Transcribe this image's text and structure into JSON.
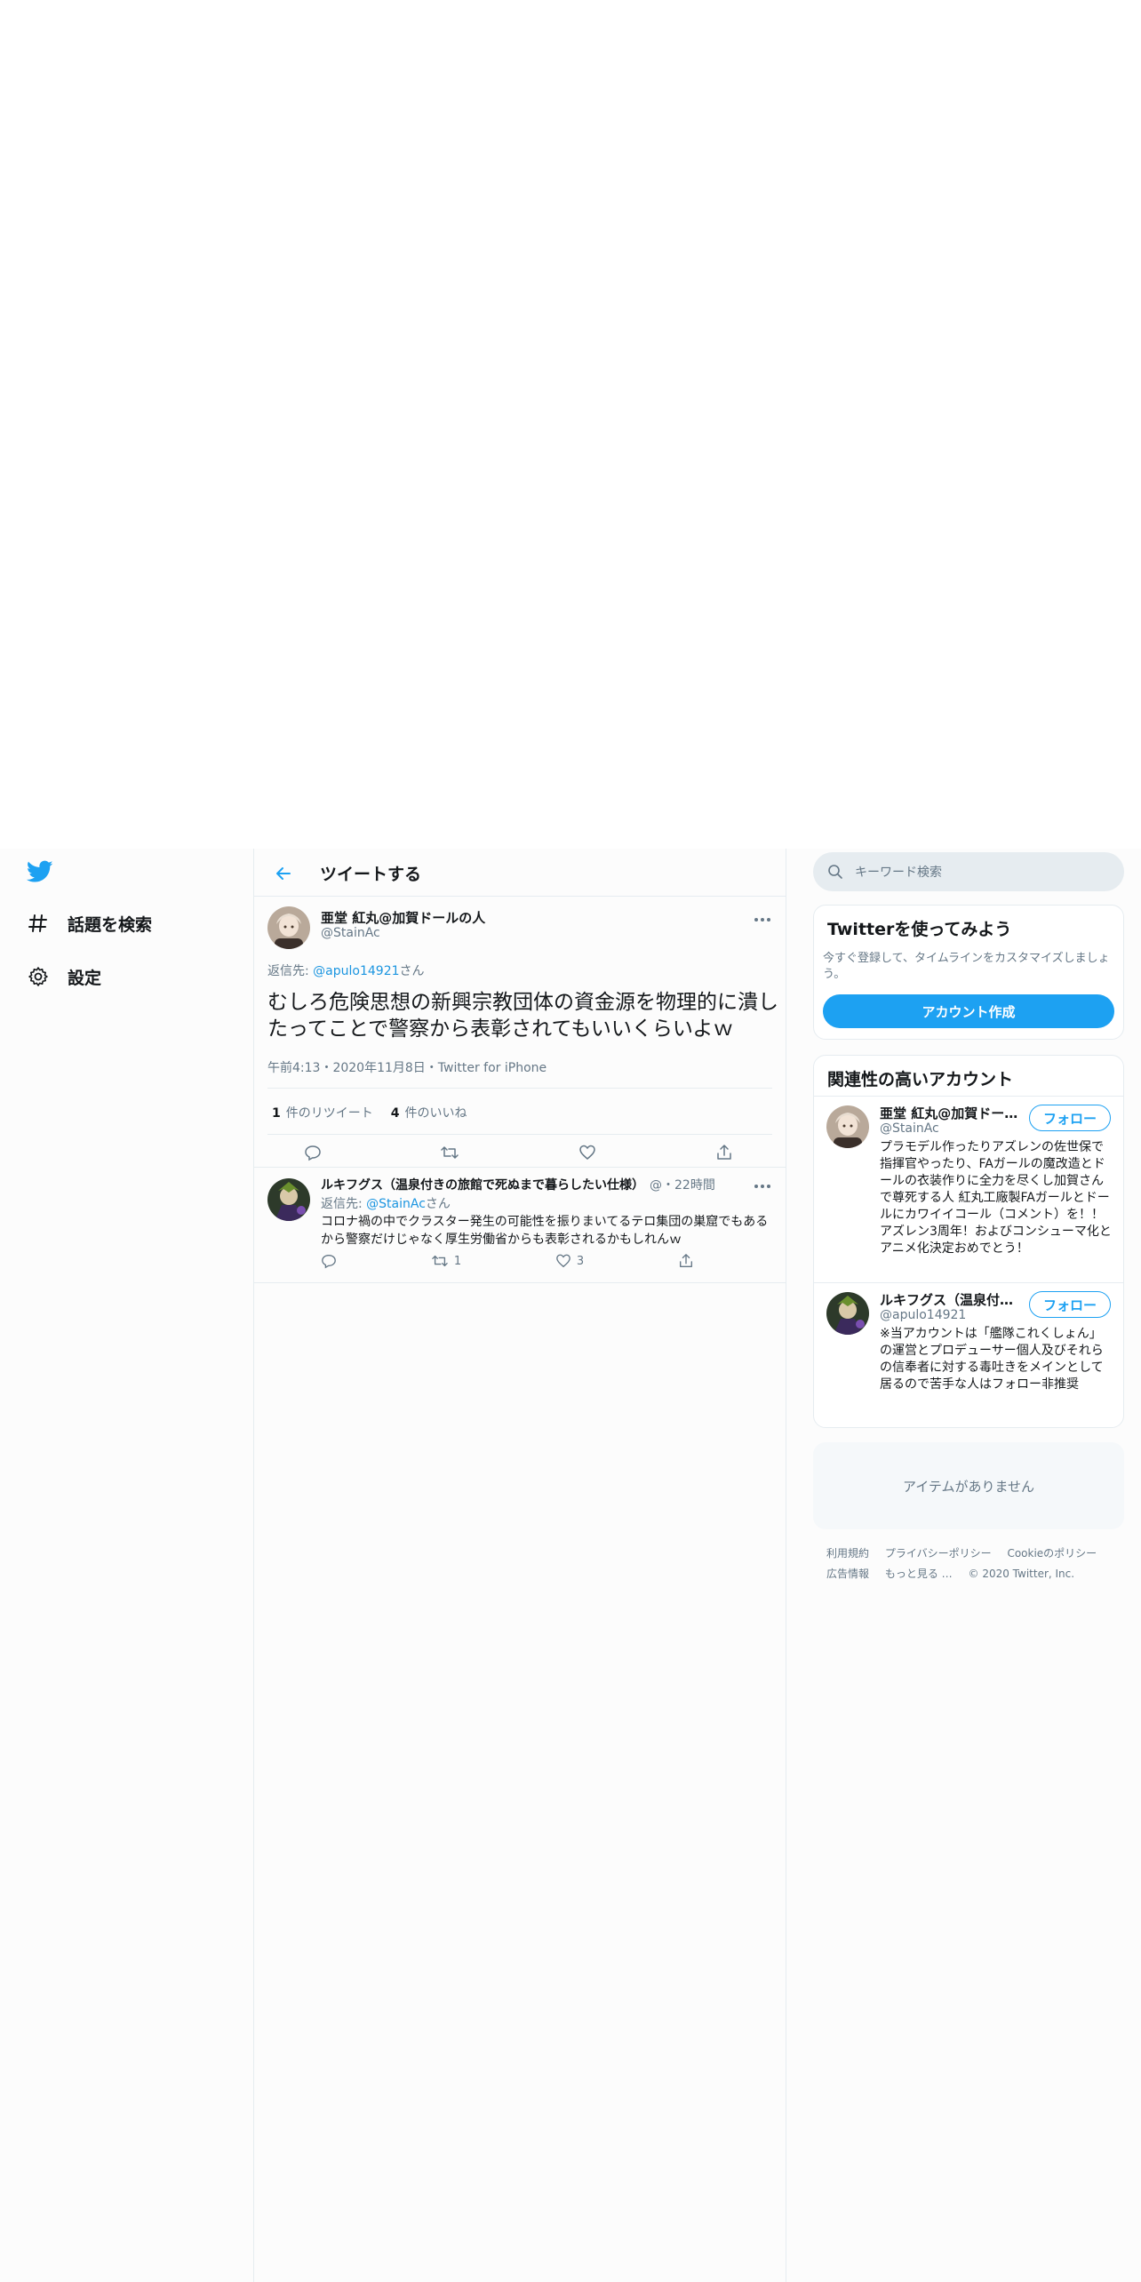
{
  "colors": {
    "brand": "#1da1f2",
    "link": "#1b95e0",
    "secondary_text": "#657786",
    "border": "#e6ecf0"
  },
  "nav": {
    "items": [
      {
        "label": "話題を検索",
        "icon": "hashtag-icon"
      },
      {
        "label": "設定",
        "icon": "gear-icon"
      }
    ]
  },
  "header": {
    "title": "ツイートする"
  },
  "main_tweet": {
    "name": "亜堂 紅丸@加賀ドールの人",
    "handle": "@StainAc",
    "reply_prefix": "返信先: ",
    "reply_to": "@apulo14921",
    "reply_suffix": "さん",
    "text": "むしろ危険思想の新興宗教団体の資金源を物理的に潰したってことで警察から表彰されてもいいくらいよｗ",
    "meta": "午前4:13・2020年11月8日・Twitter for iPhone",
    "retweets_count": "1",
    "retweets_label": "件のリツイート",
    "likes_count": "4",
    "likes_label": "件のいいね"
  },
  "reply_tweet": {
    "name": "ルキフグス（温泉付きの旅館で死ぬまで暮らしたい仕様）",
    "meta": "@・22時間",
    "reply_prefix": "返信先: ",
    "reply_to": "@StainAc",
    "reply_suffix": "さん",
    "text": "コロナ禍の中でクラスター発生の可能性を振りまいてるテロ集団の巣窟でもあるから警察だけじゃなく厚生労働省からも表彰されるかもしれんｗ",
    "retweets": "1",
    "likes": "3"
  },
  "search": {
    "placeholder": "キーワード検索"
  },
  "signup": {
    "title": "Twitterを使ってみよう",
    "desc": "今すぐ登録して、タイムラインをカスタマイズしましょう。",
    "button": "アカウント作成"
  },
  "related": {
    "title": "関連性の高いアカウント",
    "follow_label": "フォロー",
    "users": [
      {
        "name": "亜堂 紅丸@加賀ドールの人",
        "handle": "@StainAc",
        "bio": "プラモデル作ったりアズレンの佐世保で指揮官やったり、FAガールの魔改造とドールの衣装作りに全力を尽くし加賀さんで尊死する人 紅丸工廠製FAガールとドールにカワイイコール（コメント）を！！ アズレン3周年！およびコンシューマ化とアニメ化決定おめでとう！"
      },
      {
        "name": "ルキフグス（温泉付きの旅館で死ぬまで暮らしたい仕様）",
        "handle": "@apulo14921",
        "bio": "※当アカウントは「艦隊これくしょん」の運営とプロデューサー個人及びそれらの信奉者に対する毒吐きをメインとして居るので苦手な人はフォロー非推奨"
      }
    ]
  },
  "empty": {
    "text": "アイテムがありません"
  },
  "footer": {
    "links": [
      "利用規約",
      "プライバシーポリシー",
      "Cookieのポリシー",
      "広告情報",
      "もっと見る …"
    ],
    "copyright": "© 2020 Twitter, Inc."
  }
}
